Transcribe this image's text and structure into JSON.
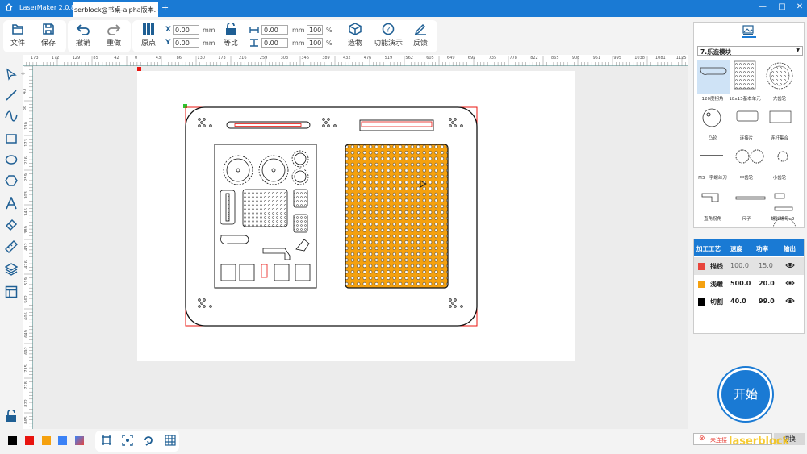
{
  "titlebar": {
    "app_name": "LaserMaker 2.0.8",
    "doc_tab": "serblock@书桌-alpha版本.lc",
    "new_tab": "+",
    "minimize": "—",
    "maximize": "□",
    "close": "✕"
  },
  "toolbar": {
    "file": "文件",
    "save": "保存",
    "undo": "撤销",
    "redo": "重做",
    "origin": "原点",
    "x_label": "X",
    "x_value": "0.00",
    "y_label": "Y",
    "y_value": "0.00",
    "mm": "mm",
    "ratio": "等比",
    "w_value": "0.00",
    "h_value": "0.00",
    "w_pct": "100",
    "h_pct": "100",
    "pct": "%",
    "build": "造物",
    "demo": "功能演示",
    "feedback": "反馈"
  },
  "ruler": {
    "h_ticks": [
      "173",
      "172",
      "129",
      "85",
      "42",
      "0",
      "43",
      "86",
      "130",
      "173",
      "216",
      "259",
      "303",
      "346",
      "389",
      "432",
      "476",
      "519",
      "562",
      "605",
      "649",
      "692",
      "735",
      "778",
      "822",
      "865",
      "908",
      "951",
      "995",
      "1038",
      "1081",
      "1125"
    ],
    "v_ticks": [
      "0",
      "43",
      "86",
      "130",
      "173",
      "216",
      "259",
      "303",
      "346",
      "389",
      "432",
      "476",
      "519",
      "562",
      "605",
      "649",
      "692",
      "735",
      "778",
      "822",
      "865"
    ]
  },
  "colors": {
    "black": "#000000",
    "red": "#e8140f",
    "orange": "#f5a10f",
    "blue": "#3b82f6",
    "gradient": "#c070c0",
    "accent": "#1a7ad4"
  },
  "library": {
    "category": "7.乐造模块",
    "items": [
      "120度拐角",
      "18x13基本单元",
      "大齿轮",
      "凸轮",
      "连接片",
      "连杆集合",
      "M3一字螺丝刀",
      "中齿轮",
      "小齿轮",
      "直角拐角",
      "尺子",
      "螺丝螺母x2"
    ]
  },
  "process": {
    "headers": [
      "加工工艺",
      "速度",
      "功率",
      "输出"
    ],
    "rows": [
      {
        "color": "#e8453c",
        "name": "描线",
        "speed": "100.0",
        "power": "15.0"
      },
      {
        "color": "#f5a10f",
        "name": "浅雕",
        "speed": "500.0",
        "power": "20.0"
      },
      {
        "color": "#000000",
        "name": "切割",
        "speed": "40.0",
        "power": "99.0"
      }
    ]
  },
  "start": "开始",
  "connection": {
    "status": "未连接",
    "switch": "切换"
  },
  "watermark": "laserblock"
}
